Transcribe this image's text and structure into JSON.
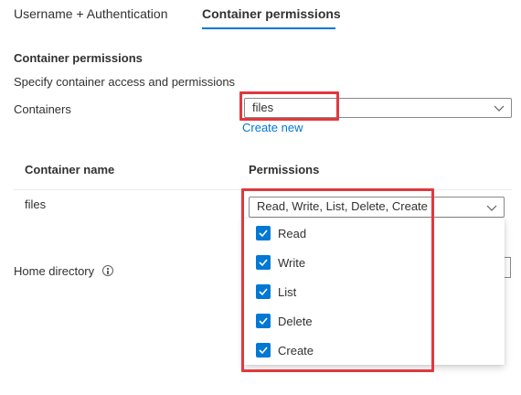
{
  "tabs": [
    {
      "label": "Username + Authentication",
      "active": false
    },
    {
      "label": "Container permissions",
      "active": true
    }
  ],
  "section": {
    "title": "Container permissions",
    "description": "Specify container access and permissions"
  },
  "containers": {
    "label": "Containers",
    "selected": "files",
    "create_new": "Create new"
  },
  "table": {
    "headers": [
      "Container name",
      "Permissions"
    ],
    "rows": [
      {
        "name": "files",
        "permissions": "Read, Write, List, Delete, Create"
      }
    ]
  },
  "home_directory": {
    "label": "Home directory"
  },
  "permission_options": [
    {
      "label": "Read",
      "checked": true
    },
    {
      "label": "Write",
      "checked": true
    },
    {
      "label": "List",
      "checked": true
    },
    {
      "label": "Delete",
      "checked": true
    },
    {
      "label": "Create",
      "checked": true
    }
  ],
  "colors": {
    "accent": "#0078d4",
    "highlight": "#e0393e"
  }
}
